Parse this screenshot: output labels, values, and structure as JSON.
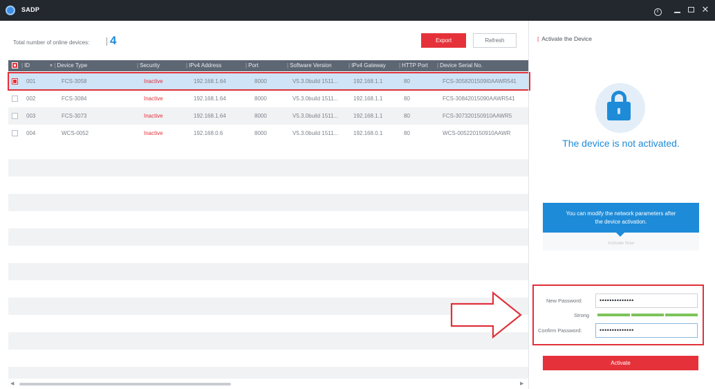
{
  "window": {
    "title": "SADP"
  },
  "summary": {
    "label": "Total number of online devices:",
    "count": "4"
  },
  "toolbar": {
    "export_label": "Export",
    "refresh_label": "Refresh"
  },
  "table": {
    "columns": [
      "ID",
      "Device Type",
      "Security",
      "IPv4 Address",
      "Port",
      "Software Version",
      "IPv4 Gateway",
      "HTTP Port",
      "Device Serial No."
    ],
    "rows": [
      {
        "id": "001",
        "type": "FCS-3058",
        "security": "Inactive",
        "ipv4": "192.168.1.64",
        "port": "8000",
        "software": "V5.3.0build 1511...",
        "gateway": "192.168.1.1",
        "http": "80",
        "serial": "FCS-3058201509I0AAWR541",
        "selected": true
      },
      {
        "id": "002",
        "type": "FCS-3084",
        "security": "Inactive",
        "ipv4": "192.168.1.64",
        "port": "8000",
        "software": "V5.3.0build 1511...",
        "gateway": "192.168.1.1",
        "http": "80",
        "serial": "FCS-30842015090AAWR541",
        "selected": false
      },
      {
        "id": "003",
        "type": "FCS-3073",
        "security": "Inactive",
        "ipv4": "192.168.1.64",
        "port": "8000",
        "software": "V5.3.0build 1511...",
        "gateway": "192.168.1.1",
        "http": "80",
        "serial": "FCS-307320150910AAWR5",
        "selected": false
      },
      {
        "id": "004",
        "type": "WCS-0052",
        "security": "Inactive",
        "ipv4": "192.168.0.6",
        "port": "8000",
        "software": "V5.3.0build 1511...",
        "gateway": "192.168.0.1",
        "http": "80",
        "serial": "WCS-005220150910AAWR",
        "selected": false
      }
    ]
  },
  "activate_panel": {
    "title": "Activate the Device",
    "status_text": "The device is not activated.",
    "tip_line1": "You can modify the network parameters after",
    "tip_line2": "the device activation.",
    "tip_link": "Activate Now",
    "new_password_label": "New Password:",
    "new_password_value": "••••••••••••••",
    "strength_label": "Strong",
    "confirm_password_label": "Confirm Password:",
    "confirm_password_value": "••••••••••••••",
    "activate_label": "Activate"
  },
  "colors": {
    "titlebar": "#23272e",
    "accent_red": "#e5323a",
    "accent_blue": "#1e8bd8",
    "strength_green": "#7cc35a",
    "selected_row": "#cfe4f7"
  },
  "icons": {
    "app": "app-logo-icon",
    "lock": "lock-icon",
    "arrow": "right-arrow-annotation-icon"
  }
}
